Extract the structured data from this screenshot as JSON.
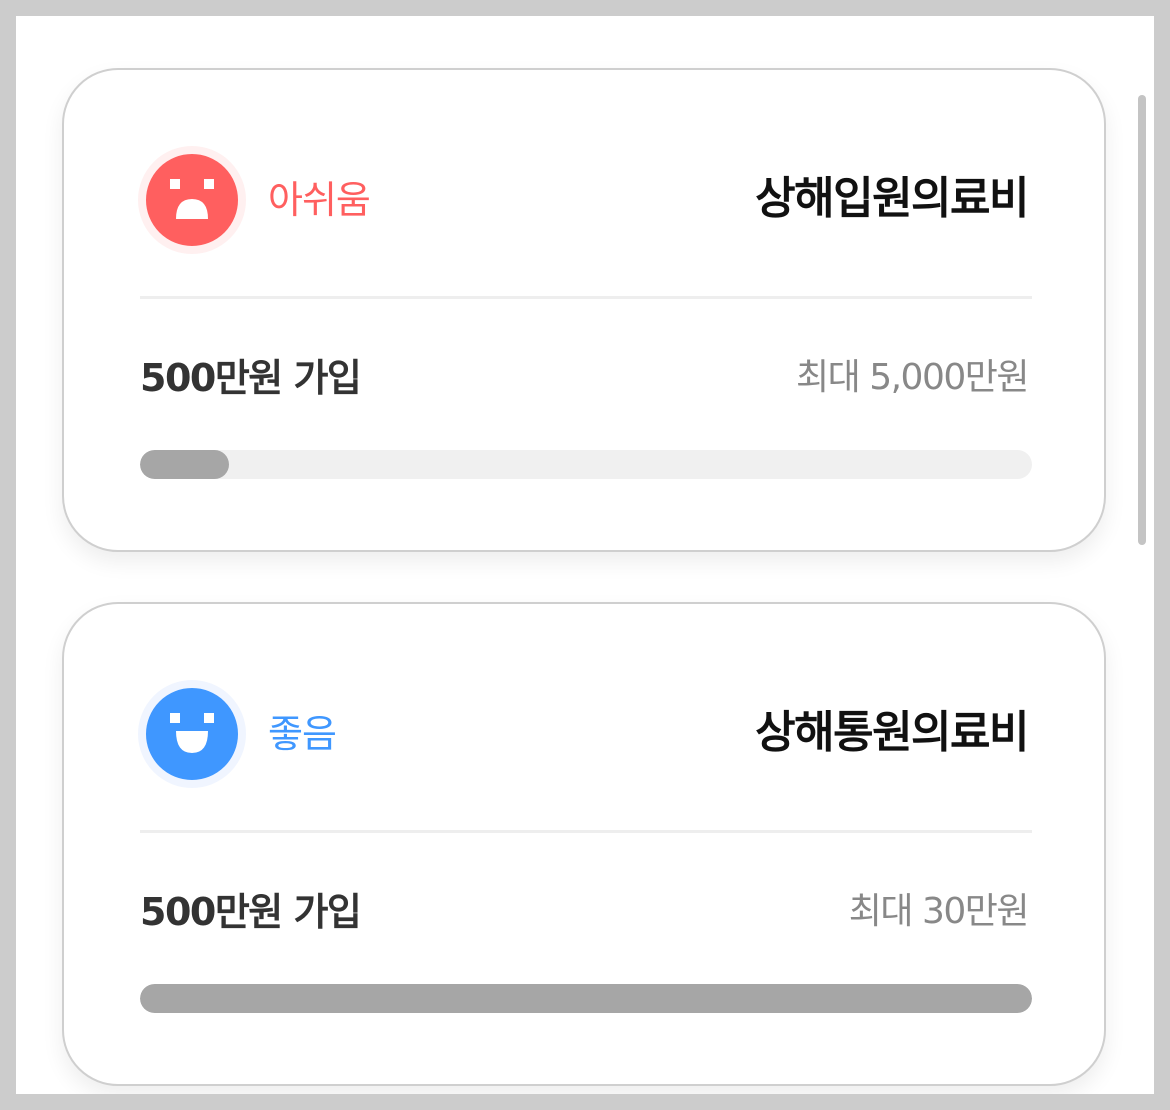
{
  "cards": [
    {
      "status": "아쉬움",
      "status_tone": "bad",
      "face_icon": "sad-face-icon",
      "title": "상해입원의료비",
      "amount": "500만원 가입",
      "max": "최대 5,000만원",
      "progress": 0.1
    },
    {
      "status": "좋음",
      "status_tone": "good",
      "face_icon": "happy-face-icon",
      "title": "상해통원의료비",
      "amount": "500만원 가입",
      "max": "최대 30만원",
      "progress": 1.0
    }
  ],
  "colors": {
    "bad": "#ff5f5f",
    "good": "#3f97ff",
    "progress_fill": "#a6a6a6",
    "progress_track": "#f0f0f0"
  }
}
